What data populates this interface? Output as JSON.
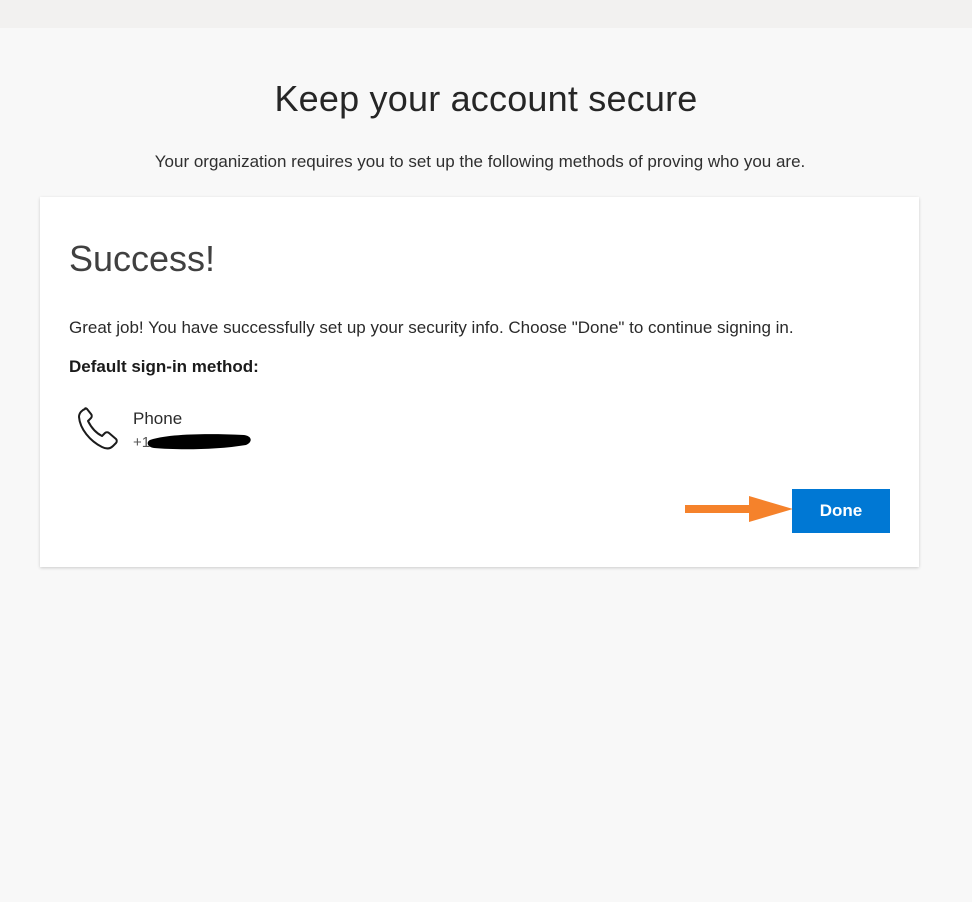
{
  "header": {
    "title": "Keep your account secure",
    "subtitle": "Your organization requires you to set up the following methods of proving who you are."
  },
  "card": {
    "title": "Success!",
    "message": "Great job! You have successfully set up your security info. Choose \"Done\" to continue signing in.",
    "default_label": "Default sign-in method:",
    "method": {
      "icon": "phone-icon",
      "name": "Phone",
      "number": "+1"
    },
    "done_label": "Done"
  },
  "colors": {
    "accent": "#0078d4",
    "annotation_arrow": "#f5822b",
    "background": "#f8f8f8"
  }
}
